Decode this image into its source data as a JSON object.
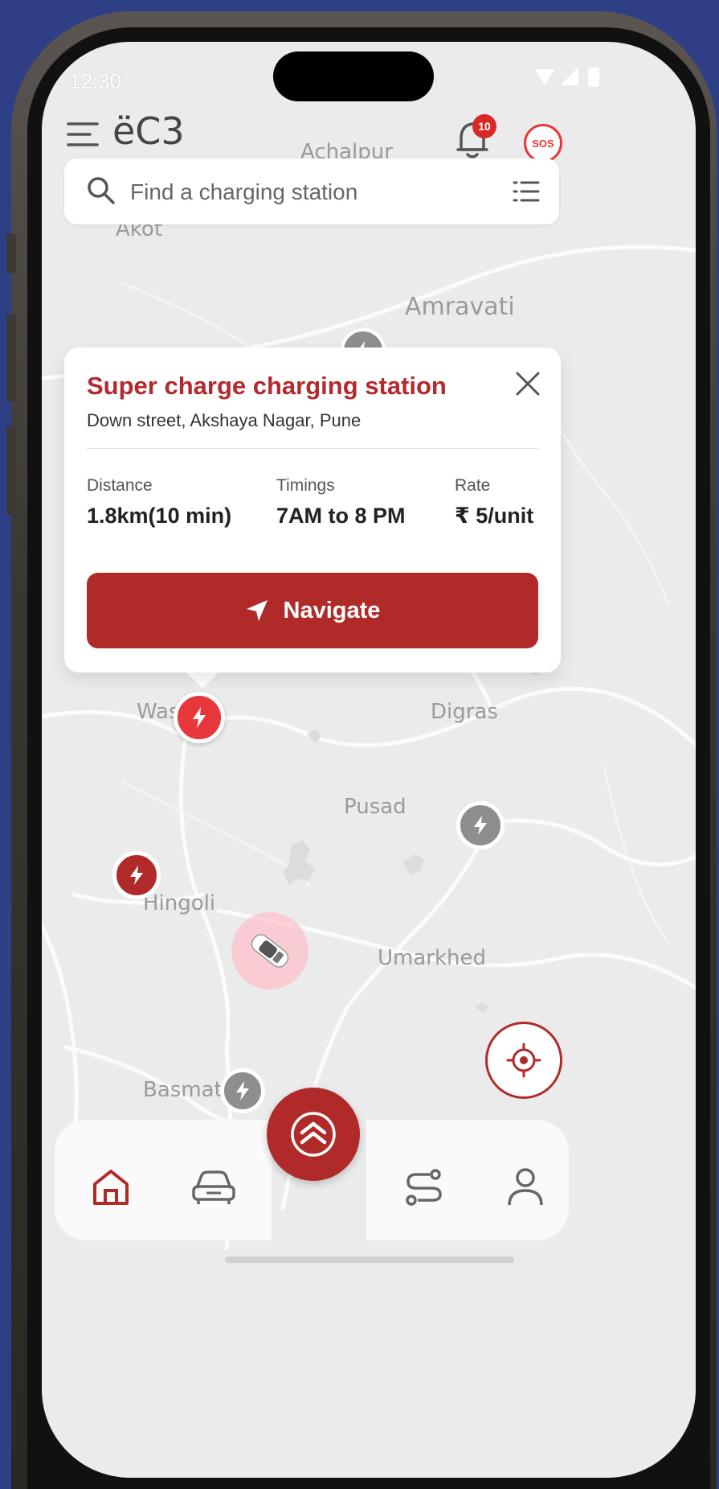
{
  "status_bar": {
    "time": "12:30"
  },
  "header": {
    "app_title": "ëC3",
    "notification_count": "10",
    "sos_label": "SOS"
  },
  "search": {
    "placeholder": "Find a charging station"
  },
  "map_labels": [
    "Achalpur",
    "Akot",
    "Amravati",
    "Washim",
    "Digras",
    "Pusad",
    "Hingoli",
    "Umarkhed",
    "Basmath"
  ],
  "card": {
    "title": "Super charge charging station",
    "address": "Down street, Akshaya Nagar, Pune",
    "stats": [
      {
        "label": "Distance",
        "value": "1.8km(10 min)"
      },
      {
        "label": "Timings",
        "value": "7AM to 8 PM"
      },
      {
        "label": "Rate",
        "value": "₹ 5/unit"
      }
    ],
    "navigate_label": "Navigate"
  },
  "colors": {
    "brand_red": "#b02a2a",
    "title_red": "#b3292d",
    "sos_red": "#e8373a",
    "inactive_pin": "#8e8e8e"
  },
  "icons": [
    "menu-icon",
    "bell-icon",
    "search-icon",
    "list-icon",
    "close-icon",
    "navigate-arrow-icon",
    "charge-icon",
    "car-icon",
    "locate-icon",
    "home-icon",
    "car-nav-icon",
    "route-icon",
    "profile-icon",
    "brand-logo-icon"
  ]
}
